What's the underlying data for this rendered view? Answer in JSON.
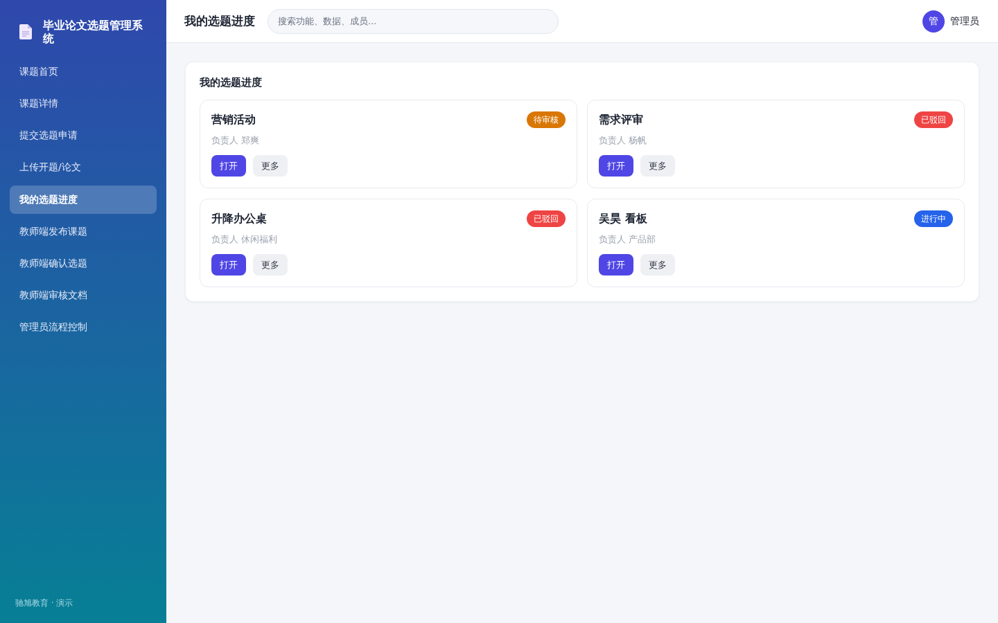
{
  "sidebar": {
    "title": "毕业论文选题管理系统",
    "items": [
      {
        "label": "课题首页",
        "selected": false
      },
      {
        "label": "课题详情",
        "selected": false
      },
      {
        "label": "提交选题申请",
        "selected": false
      },
      {
        "label": "上传开题/论文",
        "selected": false
      },
      {
        "label": "我的选题进度",
        "selected": true
      },
      {
        "label": "教师端发布课题",
        "selected": false
      },
      {
        "label": "教师端确认选题",
        "selected": false
      },
      {
        "label": "教师端审核文档",
        "selected": false
      },
      {
        "label": "管理员流程控制",
        "selected": false
      }
    ],
    "footer": "驰旭教育 · 演示"
  },
  "header": {
    "title": "我的选题进度",
    "search": {
      "placeholder": "搜索功能、数据、成员..."
    },
    "user": {
      "avatar": "管",
      "name": "管理员"
    }
  },
  "panel": {
    "title": "我的选题进度",
    "cards": [
      {
        "title": "营销活动",
        "status": "待审核",
        "color": "#d97706",
        "owner": "负责人 郑爽",
        "buttons": [
          {
            "label": "打开",
            "kind": "primary"
          },
          {
            "label": "更多",
            "kind": "secondary"
          }
        ]
      },
      {
        "title": "需求评审",
        "status": "已驳回",
        "color": "#ef4444",
        "owner": "负责人 杨帆",
        "buttons": [
          {
            "label": "打开",
            "kind": "primary"
          },
          {
            "label": "更多",
            "kind": "secondary"
          }
        ]
      },
      {
        "title": "升降办公桌",
        "status": "已驳回",
        "color": "#ef4444",
        "owner": "负责人 休闲福利",
        "buttons": [
          {
            "label": "打开",
            "kind": "primary"
          },
          {
            "label": "更多",
            "kind": "secondary"
          }
        ]
      },
      {
        "title": "吴昊 看板",
        "status": "进行中",
        "color": "#2563eb",
        "owner": "负责人 产品部",
        "buttons": [
          {
            "label": "打开",
            "kind": "primary"
          },
          {
            "label": "更多",
            "kind": "secondary"
          }
        ]
      }
    ]
  }
}
